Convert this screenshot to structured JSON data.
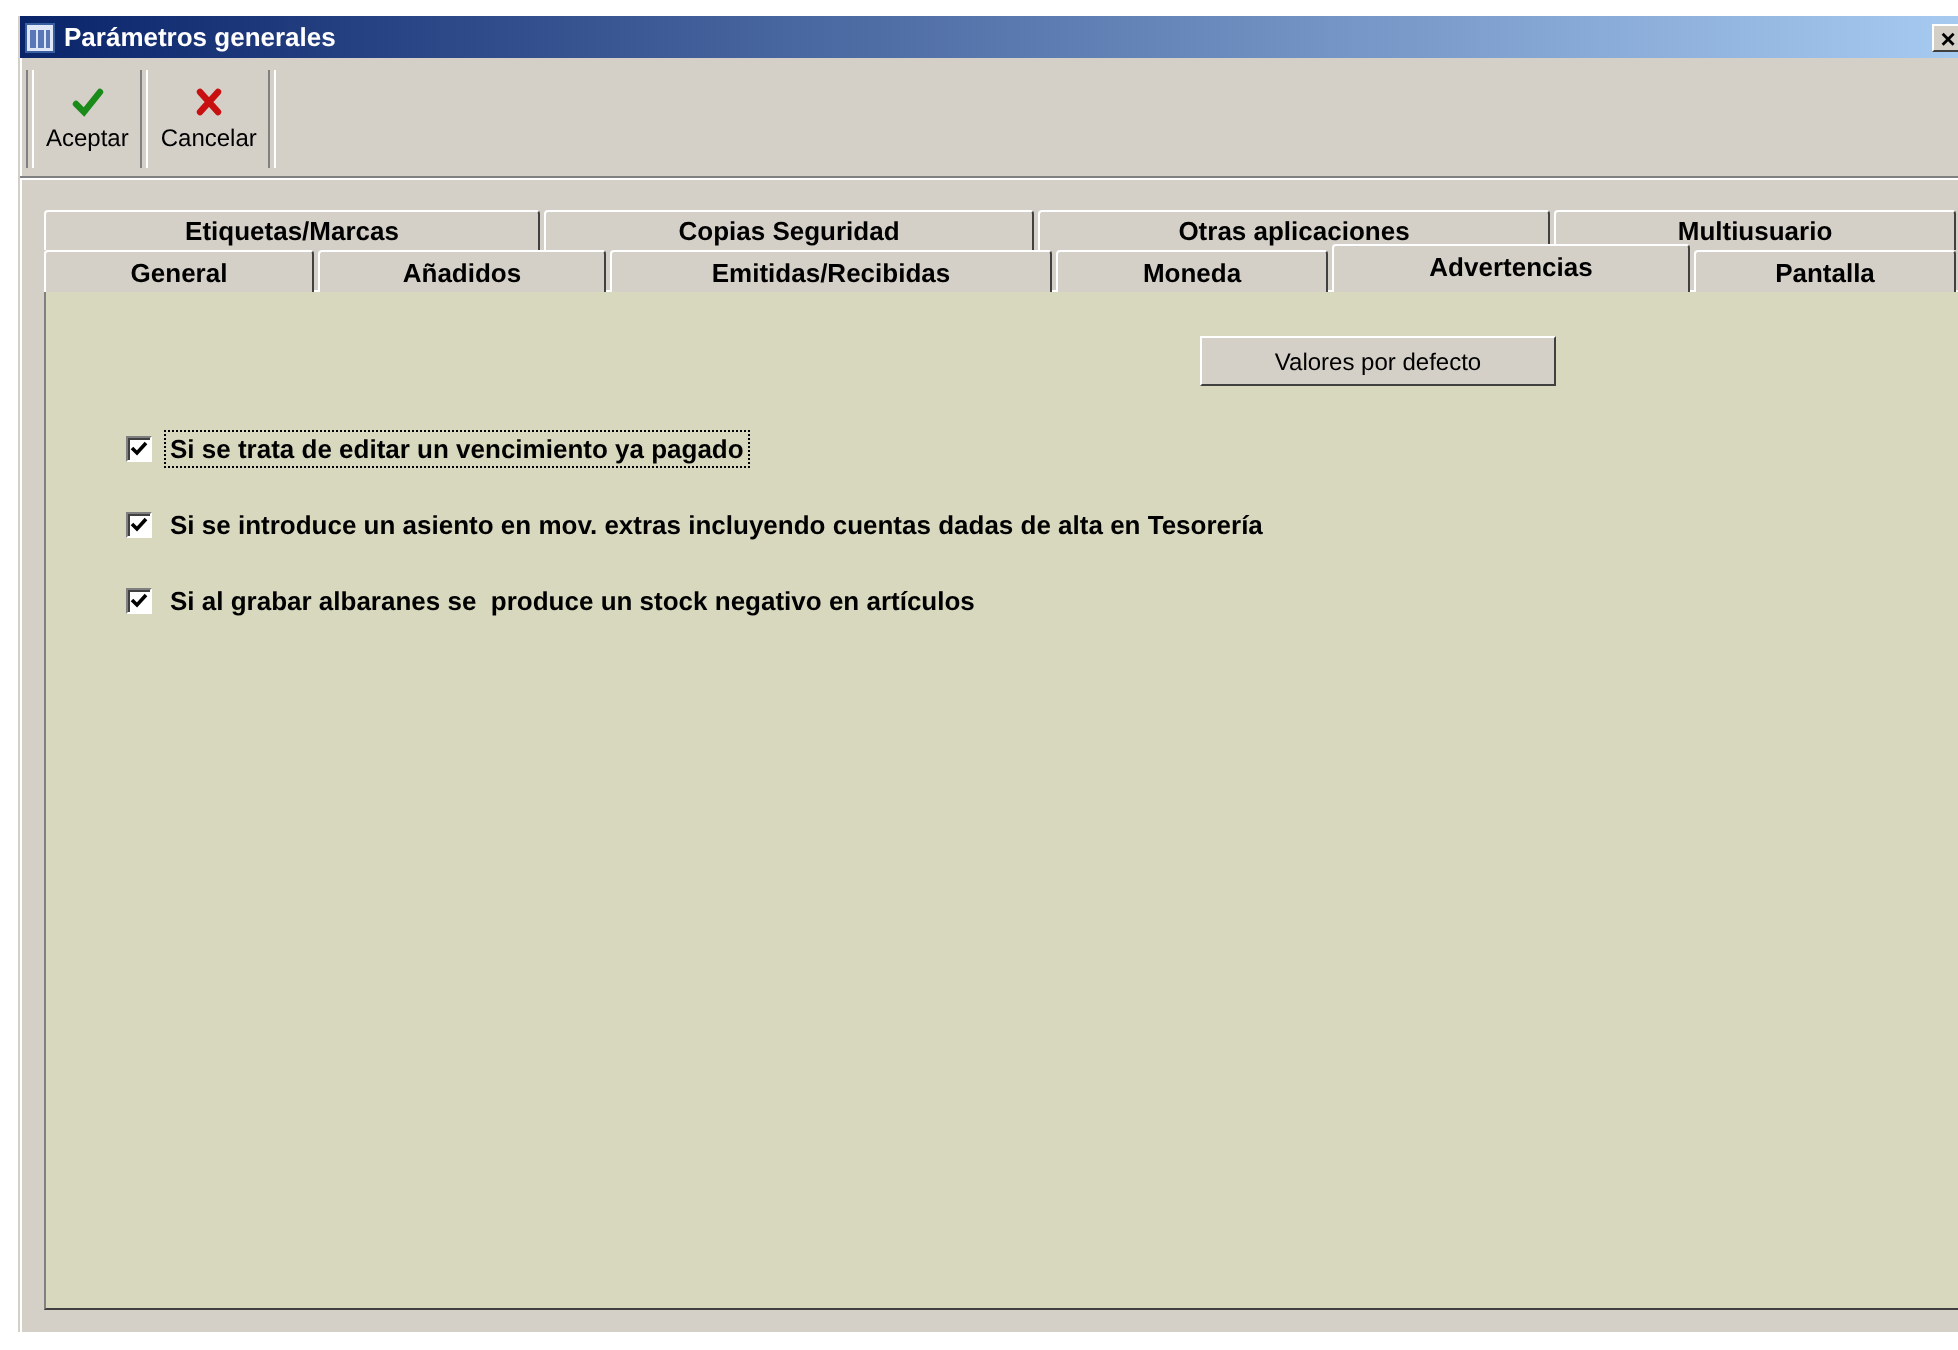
{
  "window": {
    "title": "Parámetros generales",
    "close": "×"
  },
  "toolbar": [
    {
      "kind": "accept",
      "label": "Aceptar"
    },
    {
      "kind": "cancel",
      "label": "Cancelar"
    }
  ],
  "tab_rows": [
    [
      {
        "label": "Etiquetas/Marcas",
        "selected": false
      },
      {
        "label": "Copias Seguridad",
        "selected": false
      },
      {
        "label": "Otras aplicaciones",
        "selected": false
      },
      {
        "label": "Multiusuario",
        "selected": false
      }
    ],
    [
      {
        "label": "General",
        "selected": false
      },
      {
        "label": "Añadidos",
        "selected": false
      },
      {
        "label": "Emitidas/Recibidas",
        "selected": false
      },
      {
        "label": "Moneda",
        "selected": false
      },
      {
        "label": "Advertencias",
        "selected": true
      },
      {
        "label": "Pantalla",
        "selected": false
      }
    ]
  ],
  "default_button": "Valores por defecto",
  "options": [
    {
      "label": "Si se trata de editar un vencimiento ya pagado",
      "checked": true,
      "focused": true
    },
    {
      "label": "Si se introduce un asiento en mov. extras incluyendo cuentas dadas de alta en Tesorería",
      "checked": true,
      "focused": false
    },
    {
      "label": "Si al grabar albaranes se  produce un stock negativo en artículos",
      "checked": true,
      "focused": false
    }
  ]
}
